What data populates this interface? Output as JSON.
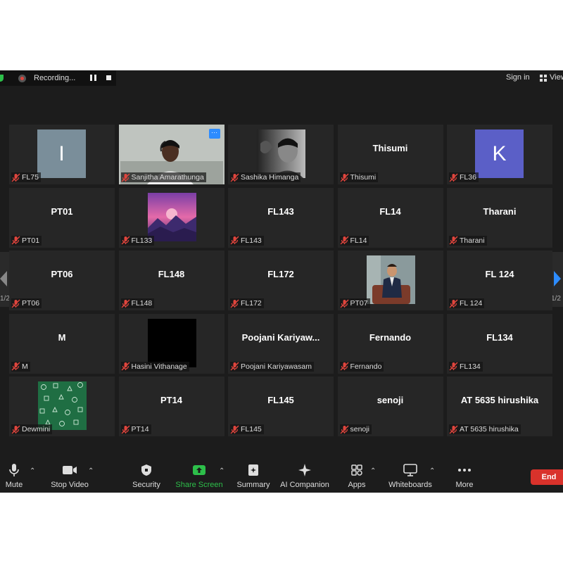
{
  "topbar": {
    "recording_label": "Recording...",
    "signin_label": "Sign in",
    "view_label": "View"
  },
  "pagination": {
    "left": "1/2",
    "right": "1/2"
  },
  "tiles": [
    {
      "center": "",
      "label": "FL75",
      "avatar_letter": "I",
      "avatar_color": "#7a8e9a"
    },
    {
      "center": "",
      "label": "Sanjitha Amarathunga",
      "video": "person-webcam"
    },
    {
      "center": "",
      "label": "Sashika Himanga",
      "image": "bw-portrait"
    },
    {
      "center": "Thisumi",
      "label": "Thisumi"
    },
    {
      "center": "",
      "label": "FL36",
      "avatar_letter": "K",
      "avatar_color": "#5b5fc7"
    },
    {
      "center": "PT01",
      "label": "PT01"
    },
    {
      "center": "",
      "label": "FL133",
      "image": "purple-landscape"
    },
    {
      "center": "FL143",
      "label": "FL143"
    },
    {
      "center": "FL14",
      "label": "FL14"
    },
    {
      "center": "Tharani",
      "label": "Tharani"
    },
    {
      "center": "PT06",
      "label": "PT06"
    },
    {
      "center": "FL148",
      "label": "FL148"
    },
    {
      "center": "FL172",
      "label": "FL172"
    },
    {
      "center": "",
      "label": "PT07",
      "image": "man-on-sofa"
    },
    {
      "center": "FL 124",
      "label": "FL 124"
    },
    {
      "center": "M",
      "label": "M"
    },
    {
      "center": "",
      "label": "Hasini Vithanage",
      "image": "black"
    },
    {
      "center": "Poojani  Kariyaw...",
      "label": "Poojani Kariyawasam"
    },
    {
      "center": "Fernando",
      "label": "Fernando"
    },
    {
      "center": "FL134",
      "label": "FL134"
    },
    {
      "center": "",
      "label": "Dewmini",
      "image": "green-doodles"
    },
    {
      "center": "PT14",
      "label": "PT14"
    },
    {
      "center": "FL145",
      "label": "FL145"
    },
    {
      "center": "senoji",
      "label": "senoji"
    },
    {
      "center": "AT 5635 hirushika",
      "label": "AT 5635 hirushika"
    }
  ],
  "toolbar": {
    "mute": "Mute",
    "stop_video": "Stop Video",
    "security": "Security",
    "share_screen": "Share Screen",
    "summary": "Summary",
    "ai_companion": "AI Companion",
    "apps": "Apps",
    "whiteboards": "Whiteboards",
    "more": "More",
    "end": "End"
  },
  "colors": {
    "background": "#1c1c1c",
    "tile": "#262626",
    "active_border": "#d7e27a",
    "share_green": "#2dbf4a",
    "end_red": "#d9322b",
    "accent_blue": "#2d8cff"
  }
}
